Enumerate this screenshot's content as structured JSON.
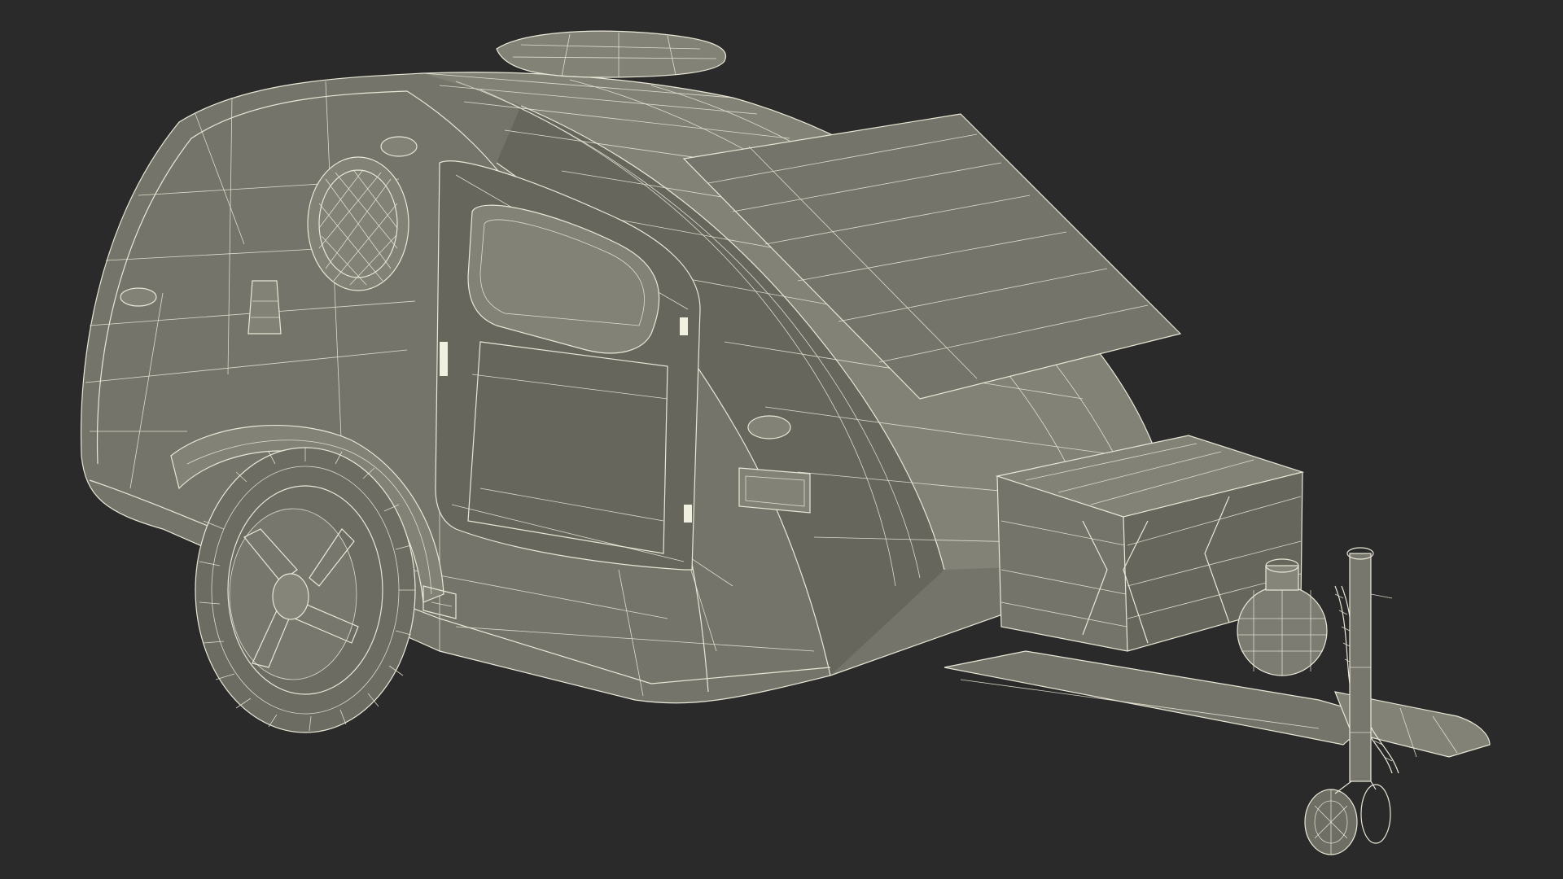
{
  "scene": {
    "background_color": "#2a2a2a",
    "model_fill_color": "#74746a",
    "wire_color": "#e9e7d6",
    "subject": "teardrop-camper-trailer-wireframe"
  }
}
